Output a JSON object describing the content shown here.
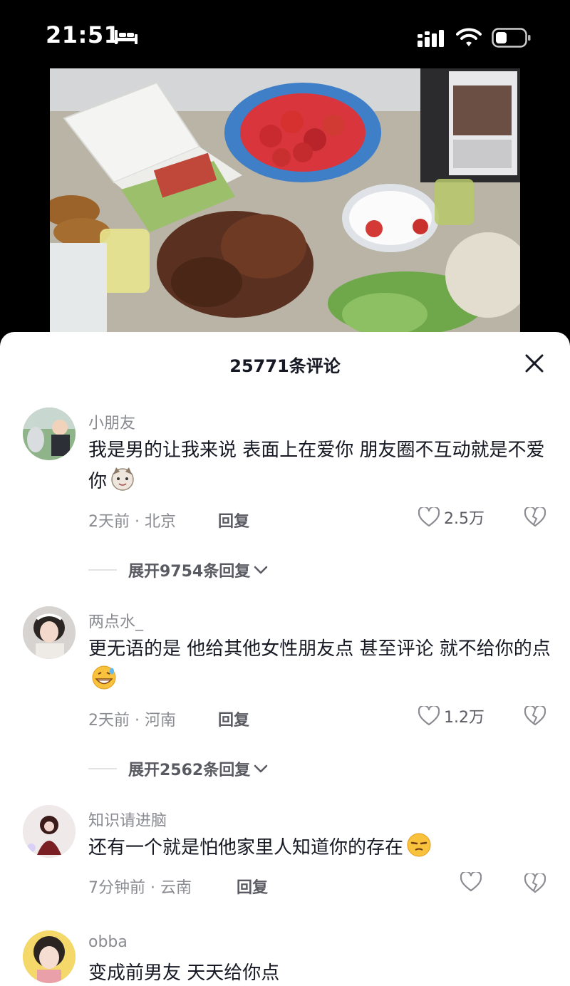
{
  "status_bar": {
    "time": "21:51",
    "icons": [
      "bed-icon",
      "signal-icon",
      "wifi-icon",
      "battery-icon"
    ]
  },
  "video": {
    "description_icon": "video-frame-image"
  },
  "comments_sheet": {
    "title": "25771条评论",
    "close_icon": "close-icon"
  },
  "comments": [
    {
      "username": "小朋友",
      "text": "我是男的让我来说 表面上在爱你 朋友圈不互动就是不爱你",
      "emoji": "cat-face-emoji",
      "time_location": "2天前 · 北京",
      "reply_label": "回复",
      "like_count": "2.5万",
      "expand_label": "展开9754条回复"
    },
    {
      "username": "两点水_",
      "text": "更无语的是 他给其他女性朋友点 甚至评论 就不给你的点",
      "emoji": "grinning-sweat-emoji",
      "time_location": "2天前 · 河南",
      "reply_label": "回复",
      "like_count": "1.2万",
      "expand_label": "展开2562条回复"
    },
    {
      "username": "知识请进脑",
      "text": "还有一个就是怕他家里人知道你的存在",
      "emoji": "unamused-emoji",
      "time_location": "7分钟前 · 云南",
      "reply_label": "回复",
      "like_count": ""
    },
    {
      "username": "obba",
      "text": "变成前男友 天天给你点"
    }
  ]
}
